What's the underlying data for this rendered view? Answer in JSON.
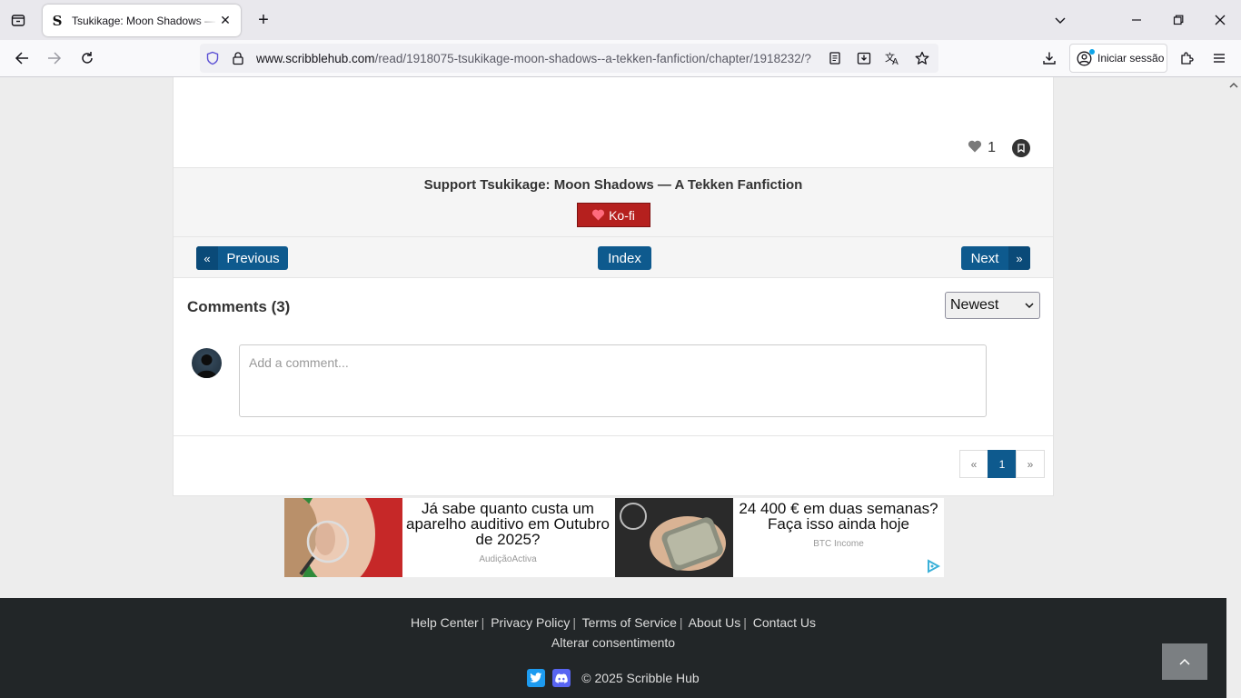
{
  "browser": {
    "tab_title": "Tsukikage: Moon Shadows — A Tekken Fanfiction",
    "url_host": "www.scribblehub.com",
    "url_path": "/read/1918075-tsukikage-moon-shadows--a-tekken-fanfiction/chapter/1918232/?",
    "signin_label": "Iniciar sessão"
  },
  "chapter": {
    "like_count": "1",
    "support_title": "Support Tsukikage: Moon Shadows — A Tekken Fanfiction",
    "kofi_label": "Ko-fi",
    "prev_label": "Previous",
    "prev_chev": "«",
    "index_label": "Index",
    "next_label": "Next",
    "next_chev": "»"
  },
  "comments": {
    "title": "Comments (3)",
    "sort_selected": "Newest",
    "placeholder": "Add a comment...",
    "pager": {
      "prev": "«",
      "current": "1",
      "next": "»"
    }
  },
  "ads": [
    {
      "headline": "Já sabe quanto custa um aparelho auditivo em Outubro de 2025?",
      "source": "AudiçãoActiva"
    },
    {
      "headline": "24 400 € em duas semanas? Faça isso ainda hoje",
      "source": "BTC Income"
    }
  ],
  "footer": {
    "links": [
      "Help Center",
      "Privacy Policy",
      "Terms of Service",
      "About Us",
      "Contact Us"
    ],
    "consent": "Alterar consentimento",
    "copyright": "© 2025 Scribble Hub"
  },
  "colors": {
    "accent": "#0e5a8e",
    "kofi": "#b5201e",
    "footer_bg": "#222628"
  }
}
